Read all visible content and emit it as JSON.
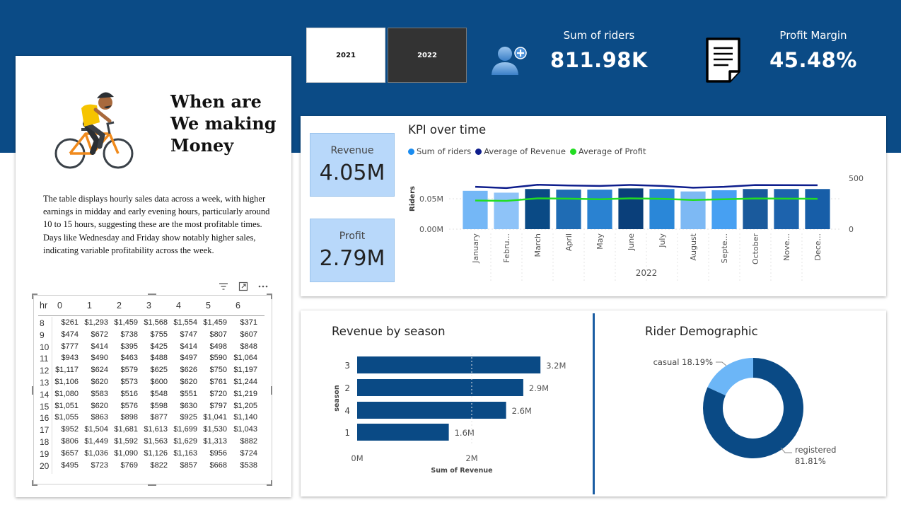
{
  "year_slicer": {
    "options": [
      "2021",
      "2022"
    ],
    "selected": "2022"
  },
  "kpis": {
    "riders_label": "Sum of riders",
    "riders_value": "811.98K",
    "margin_label": "Profit Margin",
    "margin_value": "45.48%"
  },
  "left_panel": {
    "title_lines": [
      "When are",
      "We making",
      "Money"
    ],
    "description": "The table displays hourly sales data across a week, with higher earnings in midday and early evening hours, particularly around 10 to 15 hours, suggesting these are the most profitable times. Days like Wednesday and Friday show notably higher sales, indicating variable profitability across the week."
  },
  "hourly_table": {
    "row_header": "hr",
    "columns": [
      "0",
      "1",
      "2",
      "3",
      "4",
      "5",
      "6"
    ],
    "rows": [
      {
        "hr": "8",
        "cells": [
          "$261",
          "$1,293",
          "$1,459",
          "$1,568",
          "$1,554",
          "$1,459",
          "$371"
        ]
      },
      {
        "hr": "9",
        "cells": [
          "$474",
          "$672",
          "$738",
          "$755",
          "$747",
          "$807",
          "$607"
        ]
      },
      {
        "hr": "10",
        "cells": [
          "$777",
          "$414",
          "$395",
          "$425",
          "$414",
          "$498",
          "$848"
        ]
      },
      {
        "hr": "11",
        "cells": [
          "$943",
          "$490",
          "$463",
          "$488",
          "$497",
          "$590",
          "$1,064"
        ]
      },
      {
        "hr": "12",
        "cells": [
          "$1,117",
          "$624",
          "$579",
          "$625",
          "$626",
          "$750",
          "$1,197"
        ]
      },
      {
        "hr": "13",
        "cells": [
          "$1,106",
          "$620",
          "$573",
          "$600",
          "$620",
          "$761",
          "$1,244"
        ]
      },
      {
        "hr": "14",
        "cells": [
          "$1,080",
          "$583",
          "$516",
          "$548",
          "$551",
          "$720",
          "$1,219"
        ]
      },
      {
        "hr": "15",
        "cells": [
          "$1,051",
          "$620",
          "$576",
          "$598",
          "$630",
          "$797",
          "$1,205"
        ]
      },
      {
        "hr": "16",
        "cells": [
          "$1,055",
          "$863",
          "$898",
          "$877",
          "$925",
          "$1,041",
          "$1,140"
        ]
      },
      {
        "hr": "17",
        "cells": [
          "$952",
          "$1,504",
          "$1,681",
          "$1,613",
          "$1,699",
          "$1,530",
          "$1,043"
        ]
      },
      {
        "hr": "18",
        "cells": [
          "$806",
          "$1,449",
          "$1,592",
          "$1,563",
          "$1,629",
          "$1,313",
          "$882"
        ]
      },
      {
        "hr": "19",
        "cells": [
          "$657",
          "$1,036",
          "$1,090",
          "$1,126",
          "$1,163",
          "$956",
          "$724"
        ]
      },
      {
        "hr": "20",
        "cells": [
          "$495",
          "$723",
          "$769",
          "$822",
          "$857",
          "$668",
          "$538"
        ]
      }
    ]
  },
  "cards": {
    "revenue_label": "Revenue",
    "revenue_value": "4.05M",
    "profit_label": "Profit",
    "profit_value": "2.79M"
  },
  "chart_data": [
    {
      "type": "bar",
      "title": "KPI over time",
      "legend": [
        "Sum of riders",
        "Average of Revenue",
        "Average of Profit"
      ],
      "categories": [
        "January",
        "Febru...",
        "March",
        "April",
        "May",
        "June",
        "July",
        "August",
        "Septe...",
        "October",
        "Nove...",
        "Dece..."
      ],
      "xlabel": "2022",
      "ylabel": "Riders",
      "y_ticks": [
        "0.00M",
        "0.05M"
      ],
      "y2_ticks": [
        "0",
        "500"
      ],
      "ylim": [
        0,
        0.1
      ],
      "y2lim": [
        0,
        1000
      ],
      "bar_colors": [
        "#74b7f6",
        "#8ec3f8",
        "#0a4a85",
        "#1f6cb4",
        "#2a82d1",
        "#0a3f7a",
        "#2a87d8",
        "#7db9f4",
        "#47a0f2",
        "#1a5a9c",
        "#1d63ad",
        "#175ea8"
      ],
      "series": [
        {
          "name": "Sum of riders",
          "values": [
            0.063,
            0.06,
            0.066,
            0.065,
            0.065,
            0.067,
            0.066,
            0.062,
            0.064,
            0.066,
            0.066,
            0.066
          ],
          "color": "#1a6fc7"
        },
        {
          "name": "Average of Revenue",
          "values": [
            580,
            563,
            608,
            598,
            592,
            606,
            592,
            568,
            580,
            604,
            603,
            602
          ],
          "color": "#0e1d8c"
        },
        {
          "name": "Average of Profit",
          "values": [
            392,
            388,
            422,
            418,
            410,
            422,
            416,
            400,
            410,
            420,
            418,
            416
          ],
          "color": "#22dd22"
        }
      ]
    },
    {
      "type": "bar",
      "title": "Revenue by season",
      "orientation": "horizontal",
      "categories": [
        "3",
        "2",
        "4",
        "1"
      ],
      "values": [
        3.2,
        2.9,
        2.6,
        1.6
      ],
      "value_labels": [
        "3.2M",
        "2.9M",
        "2.6M",
        "1.6M"
      ],
      "x_ticks": [
        "0M",
        "2M"
      ],
      "xlim": [
        0,
        4
      ],
      "xlabel": "Sum of Revenue",
      "ylabel": "season",
      "color": "#0a4a85"
    },
    {
      "type": "pie",
      "title": "Rider Demographic",
      "donut": true,
      "slices": [
        {
          "name": "casual",
          "label": "18.19%",
          "value": 18.19,
          "color": "#6cb6f7"
        },
        {
          "name": "registered",
          "label": "81.81%",
          "value": 81.81,
          "color": "#0a4a85"
        }
      ]
    }
  ]
}
